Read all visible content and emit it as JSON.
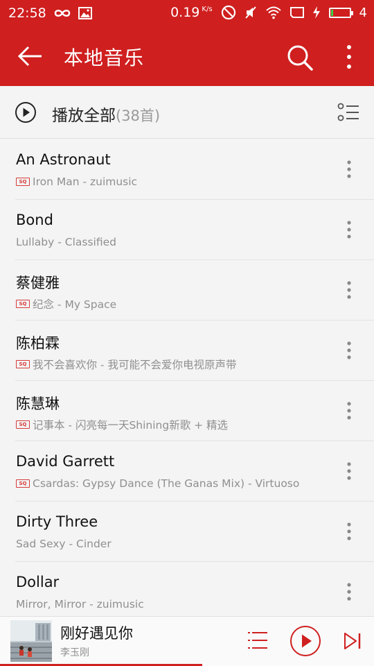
{
  "status_bar": {
    "time": "22:58",
    "speed": "0.19",
    "speed_unit": "K/s",
    "signal_label": "4",
    "battery_level": 0.15,
    "icons": [
      "infinity-icon",
      "image-icon",
      "dnd-icon",
      "mute-icon",
      "wifi-icon",
      "screen-icon",
      "charging-icon",
      "battery-icon"
    ]
  },
  "toolbar": {
    "title": "本地音乐",
    "back_icon": "arrow-left-icon",
    "search_icon": "search-icon",
    "more_icon": "more-vert-icon"
  },
  "play_all": {
    "label": "播放全部",
    "count": "(38首)"
  },
  "songs": [
    {
      "title": "An Astronaut",
      "subtitle": "Iron Man - zuimusic",
      "sq": true
    },
    {
      "title": "Bond",
      "subtitle": "Lullaby - Classified",
      "sq": false
    },
    {
      "title": "蔡健雅",
      "subtitle": "纪念 - My Space",
      "sq": true
    },
    {
      "title": "陈柏霖",
      "subtitle": "我不会喜欢你 - 我可能不会爱你电视原声带",
      "sq": true
    },
    {
      "title": "陈慧琳",
      "subtitle": "记事本 - 闪亮每一天Shining新歌 + 精选",
      "sq": true
    },
    {
      "title": "David Garrett",
      "subtitle": "Csardas: Gypsy Dance (The Ganas Mix) - Virtuoso",
      "sq": true
    },
    {
      "title": "Dirty Three",
      "subtitle": "Sad Sexy - Cinder",
      "sq": false
    },
    {
      "title": "Dollar",
      "subtitle": "Mirror, Mirror - zuimusic",
      "sq": false
    }
  ],
  "sq_badge": "SQ",
  "mini_player": {
    "title": "刚好遇见你",
    "artist": "李玉刚",
    "progress": 0.54
  },
  "colors": {
    "brand_red": "#cf1f1f",
    "background": "#f4f4f4",
    "subtitle_gray": "#8f8f8f"
  }
}
